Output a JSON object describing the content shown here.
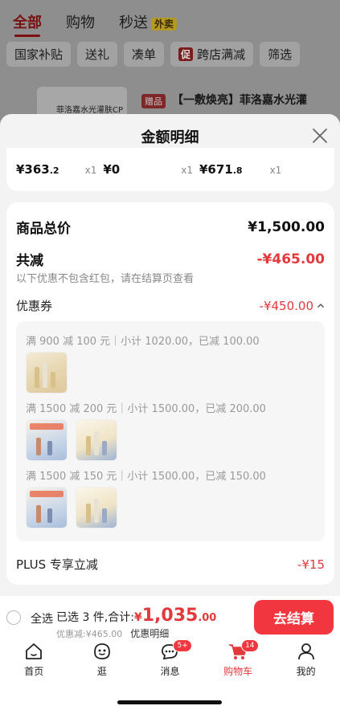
{
  "background": {
    "tabs": [
      {
        "label": "全部",
        "active": true
      },
      {
        "label": "购物",
        "active": false
      },
      {
        "label": "秒送",
        "active": false,
        "tag": "外卖"
      }
    ],
    "chips": [
      "国家补贴",
      "送礼",
      "凑单",
      "跨店满减",
      "筛选"
    ],
    "promo_tag": "促",
    "product_image_text": "菲洛嘉水光灌肤CP",
    "gift_tag": "赠品",
    "product_title": "【一敷焕亮】菲洛嘉水光灌"
  },
  "sheet": {
    "title": "金额明细",
    "items": [
      {
        "price_int": "¥363",
        "price_dec": ".2",
        "qty": "x1"
      },
      {
        "price_int": "¥0",
        "price_dec": "",
        "qty": "x1"
      },
      {
        "price_int": "¥671",
        "price_dec": ".8",
        "qty": "x1"
      }
    ],
    "goods_total_label": "商品总价",
    "goods_total_value": "¥1,500.00",
    "reduction_label": "共减",
    "reduction_value": "-¥465.00",
    "reduction_note": "以下优惠不包含红包，请在结算页查看",
    "coupon_label": "优惠券",
    "coupon_value": "-¥450.00",
    "coupon_groups": [
      {
        "text": "满 900 减 100 元｜小计 1020.00，已减 100.00",
        "thumbs": [
          "product-a"
        ]
      },
      {
        "text": "满 1500 减 200 元｜小计 1500.00，已减 200.00",
        "thumbs": [
          "product-b",
          "product-c"
        ]
      },
      {
        "text": "满 1500 减 150 元｜小计 1500.00，已减 150.00",
        "thumbs": [
          "product-b",
          "product-c"
        ]
      }
    ],
    "plus_label": "PLUS 专享立减",
    "plus_value": "-¥15"
  },
  "bottom": {
    "select_all": "全选",
    "selected_text": "已选 3 件,合计:",
    "total_currency": "¥",
    "total_int": "1,035",
    "total_dec": ".00",
    "discount_text": "优惠减:¥465.00",
    "detail_link": "优惠明细",
    "checkout_label": "去结算"
  },
  "tabbar": [
    {
      "label": "首页",
      "icon": "home-icon"
    },
    {
      "label": "逛",
      "icon": "stroll-icon"
    },
    {
      "label": "消息",
      "icon": "message-icon",
      "badge": "5+"
    },
    {
      "label": "购物车",
      "icon": "cart-icon",
      "badge": "14",
      "active": true
    },
    {
      "label": "我的",
      "icon": "profile-icon"
    }
  ],
  "colors": {
    "accent": "#e4393c",
    "checkout": "#f1363f"
  }
}
